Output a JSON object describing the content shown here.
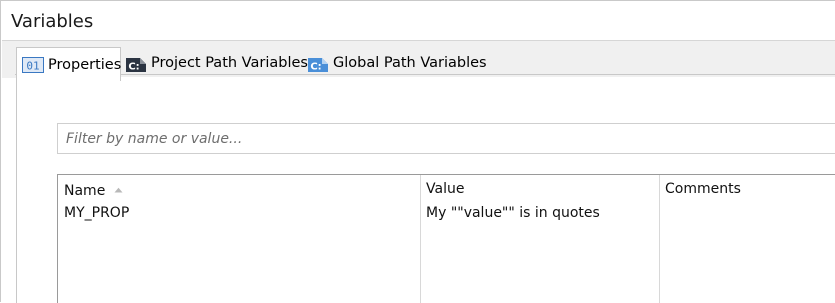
{
  "window": {
    "title": "Variables"
  },
  "tabs": [
    {
      "label": "Properties",
      "icon": "properties-icon",
      "icon_text": "01",
      "active": true
    },
    {
      "label": "Project Path Variables",
      "icon": "project-path-variables-icon",
      "icon_text": "C:",
      "active": false
    },
    {
      "label": "Global Path Variables",
      "icon": "global-path-variables-icon",
      "icon_text": "C:",
      "active": false
    }
  ],
  "filter": {
    "placeholder": "Filter by name or value...",
    "value": ""
  },
  "table": {
    "columns": [
      {
        "label": "Name",
        "sorted": "ascending"
      },
      {
        "label": "Value"
      },
      {
        "label": "Comments"
      }
    ],
    "rows": [
      {
        "name": "MY_PROP",
        "value": "My \"\"value\"\" is in quotes",
        "comments": ""
      }
    ]
  },
  "colors": {
    "tab_strip_bg": "#f0f0f0",
    "properties_icon_blue": "#3a78c2",
    "project_icon_dark": "#2b3442",
    "global_icon_blue": "#4a8fd8"
  }
}
